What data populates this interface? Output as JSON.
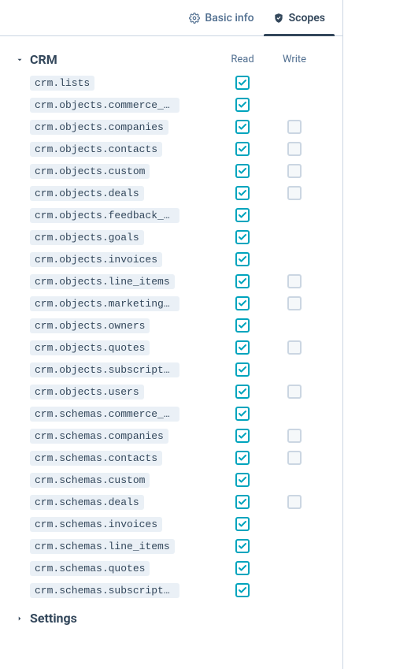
{
  "tabs": {
    "basic": {
      "label": "Basic info"
    },
    "scopes": {
      "label": "Scopes"
    }
  },
  "columns": {
    "read": "Read",
    "write": "Write"
  },
  "sections": [
    {
      "name": "CRM",
      "expanded": true,
      "scopes": [
        {
          "label": "crm.lists",
          "read": true,
          "write": "none"
        },
        {
          "label": "crm.objects.commerce_payments",
          "read": true,
          "write": "none"
        },
        {
          "label": "crm.objects.companies",
          "read": true,
          "write": false
        },
        {
          "label": "crm.objects.contacts",
          "read": true,
          "write": false
        },
        {
          "label": "crm.objects.custom",
          "read": true,
          "write": false
        },
        {
          "label": "crm.objects.deals",
          "read": true,
          "write": false
        },
        {
          "label": "crm.objects.feedback_submissions",
          "read": true,
          "write": "none"
        },
        {
          "label": "crm.objects.goals",
          "read": true,
          "write": "none"
        },
        {
          "label": "crm.objects.invoices",
          "read": true,
          "write": "none"
        },
        {
          "label": "crm.objects.line_items",
          "read": true,
          "write": false
        },
        {
          "label": "crm.objects.marketing_events",
          "read": true,
          "write": false
        },
        {
          "label": "crm.objects.owners",
          "read": true,
          "write": "none"
        },
        {
          "label": "crm.objects.quotes",
          "read": true,
          "write": false
        },
        {
          "label": "crm.objects.subscriptions",
          "read": true,
          "write": "none"
        },
        {
          "label": "crm.objects.users",
          "read": true,
          "write": false
        },
        {
          "label": "crm.schemas.commerce_payments",
          "read": true,
          "write": "none"
        },
        {
          "label": "crm.schemas.companies",
          "read": true,
          "write": false
        },
        {
          "label": "crm.schemas.contacts",
          "read": true,
          "write": false
        },
        {
          "label": "crm.schemas.custom",
          "read": true,
          "write": "none"
        },
        {
          "label": "crm.schemas.deals",
          "read": true,
          "write": false
        },
        {
          "label": "crm.schemas.invoices",
          "read": true,
          "write": "none"
        },
        {
          "label": "crm.schemas.line_items",
          "read": true,
          "write": "none"
        },
        {
          "label": "crm.schemas.quotes",
          "read": true,
          "write": "none"
        },
        {
          "label": "crm.schemas.subscriptions",
          "read": true,
          "write": "none"
        }
      ]
    },
    {
      "name": "Settings",
      "expanded": false,
      "scopes": []
    }
  ],
  "colors": {
    "accent": "#00a4bd",
    "border": "#cbd6e2",
    "text": "#33475b",
    "muted": "#516f90",
    "chip_bg": "#eaf0f6"
  }
}
